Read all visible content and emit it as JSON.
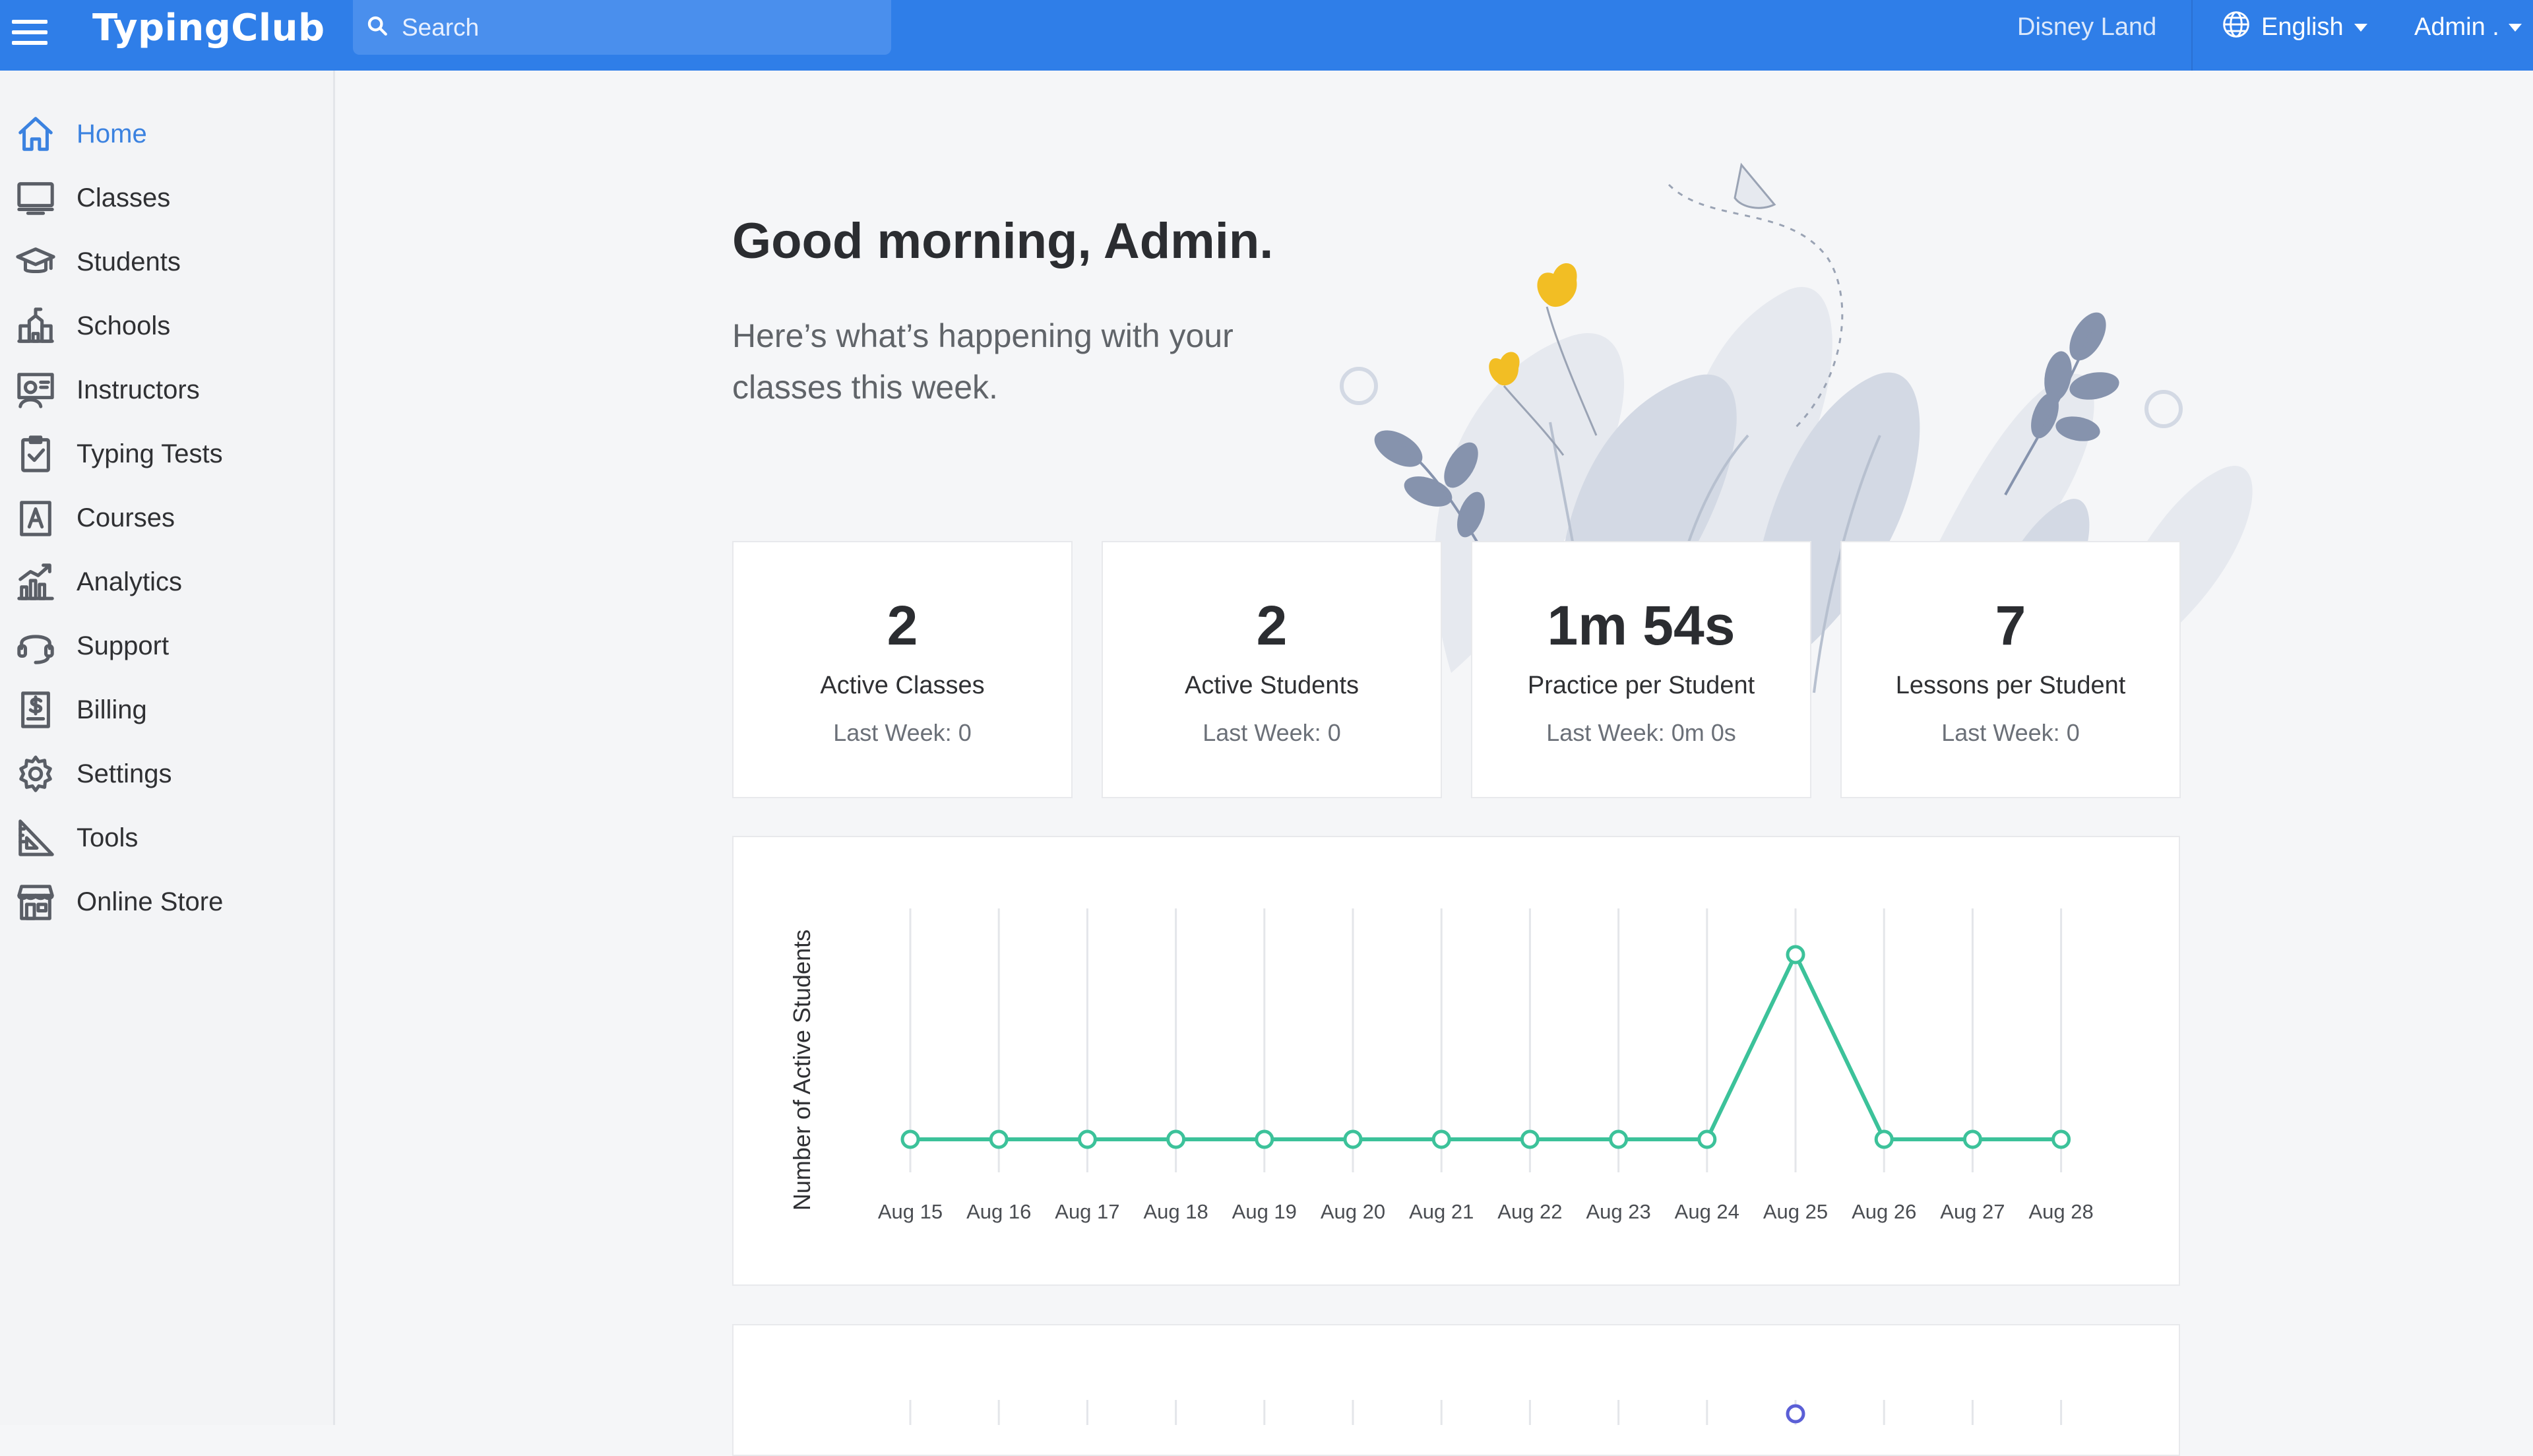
{
  "app": {
    "brand": "TypingClub",
    "search_placeholder": "Search",
    "school_name": "Disney Land",
    "language": "English",
    "user": "Admin ."
  },
  "sidebar": {
    "items": [
      {
        "label": "Home",
        "icon": "home-icon",
        "active": true
      },
      {
        "label": "Classes",
        "icon": "monitor-icon"
      },
      {
        "label": "Students",
        "icon": "graduation-cap-icon"
      },
      {
        "label": "Schools",
        "icon": "school-building-icon"
      },
      {
        "label": "Instructors",
        "icon": "instructor-board-icon"
      },
      {
        "label": "Typing Tests",
        "icon": "clipboard-check-icon"
      },
      {
        "label": "Courses",
        "icon": "letter-a-book-icon"
      },
      {
        "label": "Analytics",
        "icon": "bar-chart-icon"
      },
      {
        "label": "Support",
        "icon": "headset-icon"
      },
      {
        "label": "Billing",
        "icon": "dollar-document-icon"
      },
      {
        "label": "Settings",
        "icon": "gear-icon"
      },
      {
        "label": "Tools",
        "icon": "ruler-triangle-icon"
      },
      {
        "label": "Online Store",
        "icon": "store-icon"
      }
    ]
  },
  "main": {
    "greeting": "Good morning, Admin.",
    "subtext": "Here’s what’s happening with your classes this week.",
    "stats": [
      {
        "value": "2",
        "label": "Active Classes",
        "sub": "Last Week: 0"
      },
      {
        "value": "2",
        "label": "Active Students",
        "sub": "Last Week: 0"
      },
      {
        "value": "1m 54s",
        "label": "Practice per Student",
        "sub": "Last Week: 0m 0s"
      },
      {
        "value": "7",
        "label": "Lessons per Student",
        "sub": "Last Week: 0"
      }
    ]
  },
  "colors": {
    "topbar": "#2f7ee8",
    "accent": "#3b82e0",
    "series_line": "#3cc29a",
    "second_chart_point": "#5b5fd6"
  },
  "chart_data": {
    "type": "line",
    "ylabel": "Number of Active Students",
    "xlabel": "",
    "categories": [
      "Aug 15",
      "Aug 16",
      "Aug 17",
      "Aug 18",
      "Aug 19",
      "Aug 20",
      "Aug 21",
      "Aug 22",
      "Aug 23",
      "Aug 24",
      "Aug 25",
      "Aug 26",
      "Aug 27",
      "Aug 28"
    ],
    "values": [
      0,
      0,
      0,
      0,
      0,
      0,
      0,
      0,
      0,
      0,
      2,
      0,
      0,
      0
    ],
    "ylim": [
      0,
      2.5
    ],
    "grid": "vertical"
  }
}
